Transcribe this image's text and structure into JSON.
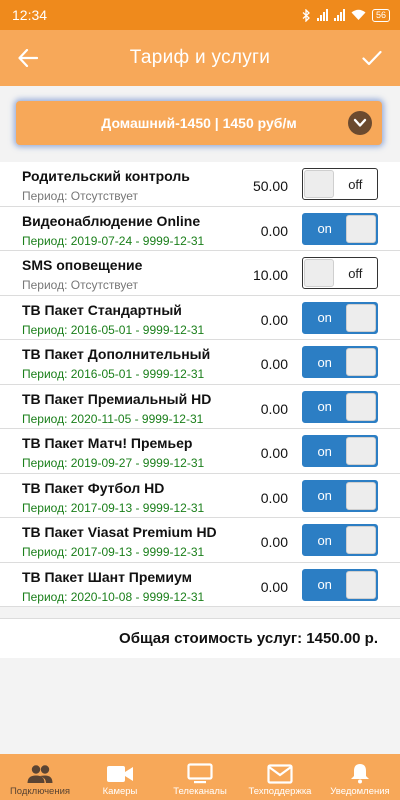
{
  "status_bar": {
    "time": "12:34",
    "battery": "56"
  },
  "app_bar": {
    "title": "Тариф и услуги",
    "back_icon": "arrow-left-icon",
    "confirm_icon": "check-icon"
  },
  "tariff": {
    "label": "Домашний-1450 | 1450 руб/м",
    "dropdown_icon": "chevron-down-icon"
  },
  "services": [
    {
      "name": "Родительский контроль",
      "period": "Период: Отсутствует",
      "price": "50.00",
      "state": "off",
      "toggle_label": "off"
    },
    {
      "name": "Видеонаблюдение Online",
      "period": "Период: 2019-07-24 - 9999-12-31",
      "price": "0.00",
      "state": "on",
      "toggle_label": "on"
    },
    {
      "name": "SMS оповещение",
      "period": "Период: Отсутствует",
      "price": "10.00",
      "state": "off",
      "toggle_label": "off"
    },
    {
      "name": "ТВ Пакет Стандартный",
      "period": "Период: 2016-05-01 - 9999-12-31",
      "price": "0.00",
      "state": "on",
      "toggle_label": "on"
    },
    {
      "name": "ТВ Пакет Дополнительный",
      "period": "Период: 2016-05-01 - 9999-12-31",
      "price": "0.00",
      "state": "on",
      "toggle_label": "on"
    },
    {
      "name": "ТВ Пакет Премиальный HD",
      "period": "Период: 2020-11-05 - 9999-12-31",
      "price": "0.00",
      "state": "on",
      "toggle_label": "on"
    },
    {
      "name": "ТВ Пакет Матч! Премьер",
      "period": "Период: 2019-09-27 - 9999-12-31",
      "price": "0.00",
      "state": "on",
      "toggle_label": "on"
    },
    {
      "name": "ТВ Пакет Футбол HD",
      "period": "Период: 2017-09-13 - 9999-12-31",
      "price": "0.00",
      "state": "on",
      "toggle_label": "on"
    },
    {
      "name": "ТВ Пакет Viasat Premium HD",
      "period": "Период: 2017-09-13 - 9999-12-31",
      "price": "0.00",
      "state": "on",
      "toggle_label": "on"
    },
    {
      "name": "ТВ Пакет Шант Премиум",
      "period": "Период: 2020-10-08 - 9999-12-31",
      "price": "0.00",
      "state": "on",
      "toggle_label": "on"
    }
  ],
  "total": {
    "text": "Общая стоимость услуг: 1450.00 р."
  },
  "bottom_nav": [
    {
      "label": "Подключения",
      "icon": "people-icon",
      "active": true
    },
    {
      "label": "Камеры",
      "icon": "camera-icon",
      "active": false
    },
    {
      "label": "Телеканалы",
      "icon": "tv-icon",
      "active": false
    },
    {
      "label": "Техподдержка",
      "icon": "mail-icon",
      "active": false
    },
    {
      "label": "Уведомления",
      "icon": "bell-icon",
      "active": false
    }
  ],
  "colors": {
    "status_bar": "#ef8a1c",
    "primary": "#f7a859",
    "toggle_on": "#2c7ec4",
    "period_green": "#1a7f1a",
    "nav_active": "#5a4433"
  }
}
